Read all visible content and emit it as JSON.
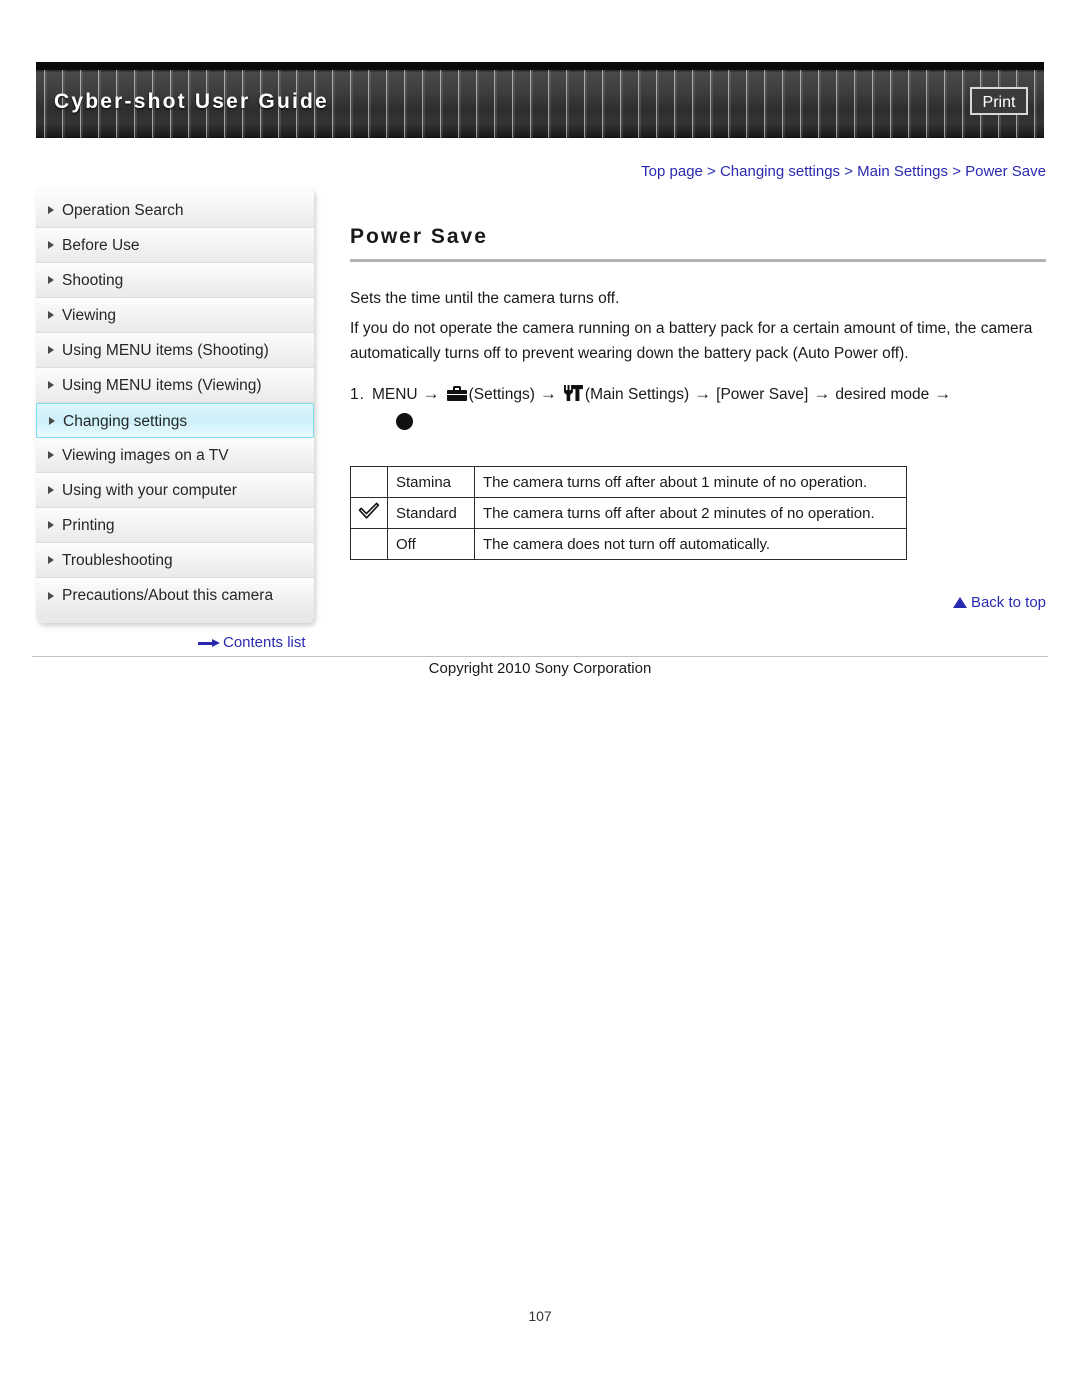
{
  "header": {
    "title": "Cyber-shot User Guide",
    "print_label": "Print"
  },
  "breadcrumb": {
    "text": "Top page > Changing settings > Main Settings > Power Save"
  },
  "sidebar": {
    "items": [
      {
        "label": "Operation Search",
        "active": false
      },
      {
        "label": "Before Use",
        "active": false
      },
      {
        "label": "Shooting",
        "active": false
      },
      {
        "label": "Viewing",
        "active": false
      },
      {
        "label": "Using MENU items (Shooting)",
        "active": false
      },
      {
        "label": "Using MENU items (Viewing)",
        "active": false
      },
      {
        "label": "Changing settings",
        "active": true
      },
      {
        "label": "Viewing images on a TV",
        "active": false
      },
      {
        "label": "Using with your computer",
        "active": false
      },
      {
        "label": "Printing",
        "active": false
      },
      {
        "label": "Troubleshooting",
        "active": false
      },
      {
        "label": "Precautions/About this camera",
        "active": false
      }
    ],
    "contents_list_label": "Contents list"
  },
  "main": {
    "title": "Power Save",
    "paragraph_1": "Sets the time until the camera turns off.",
    "paragraph_2": "If you do not operate the camera running on a battery pack for a certain amount of time, the camera automatically turns off to prevent wearing down the battery pack (Auto Power off).",
    "step": {
      "number": "1.",
      "menu_label": "MENU",
      "arrow": "→",
      "settings_label": "(Settings)",
      "main_settings_label": "(Main Settings)",
      "power_save_label": "[Power Save]",
      "desired_mode_label": "desired mode"
    },
    "table": {
      "rows": [
        {
          "checked": false,
          "mode": "Stamina",
          "description": "The camera turns off after about 1 minute of no operation."
        },
        {
          "checked": true,
          "mode": "Standard",
          "description": "The camera turns off after about 2 minutes of no operation."
        },
        {
          "checked": false,
          "mode": "Off",
          "description": "The camera does not turn off automatically."
        }
      ]
    },
    "back_to_top_label": "Back to top"
  },
  "footer": {
    "copyright": "Copyright 2010 Sony Corporation",
    "page_number": "107"
  },
  "colors": {
    "link_blue": "#2a2ab0",
    "highlight_cyan": "#cdf0fa",
    "header_dark": "#2e2e2e"
  }
}
